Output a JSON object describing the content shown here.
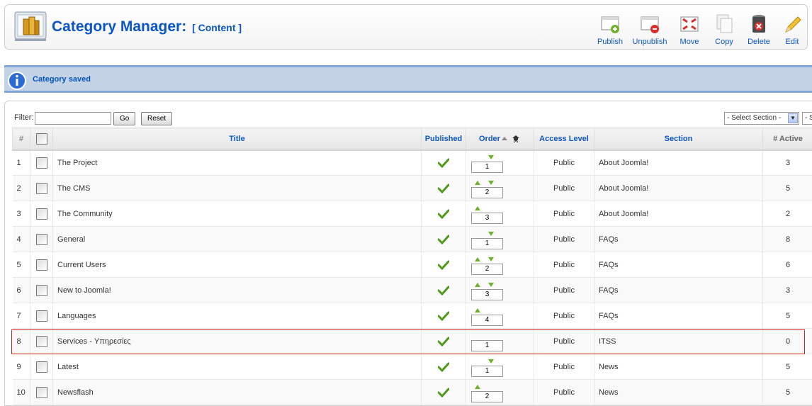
{
  "header": {
    "title": "Category Manager:",
    "subtitle": "[ Content ]"
  },
  "toolbar": {
    "publish": "Publish",
    "unpublish": "Unpublish",
    "move": "Move",
    "copy": "Copy",
    "delete": "Delete",
    "edit": "Edit"
  },
  "message": {
    "text": "Category saved"
  },
  "filter": {
    "label": "Filter:",
    "value": "",
    "go": "Go",
    "reset": "Reset",
    "section_select": "- Select Section -",
    "second_select": "- S"
  },
  "columns": {
    "num": "#",
    "title": "Title",
    "published": "Published",
    "order": "Order",
    "access": "Access Level",
    "section": "Section",
    "active": "# Active"
  },
  "rows": [
    {
      "num": "1",
      "title": "The Project",
      "up": false,
      "down": true,
      "order": "1",
      "access": "Public",
      "section": "About Joomla!",
      "active": "3"
    },
    {
      "num": "2",
      "title": "The CMS",
      "up": true,
      "down": true,
      "order": "2",
      "access": "Public",
      "section": "About Joomla!",
      "active": "5"
    },
    {
      "num": "3",
      "title": "The Community",
      "up": true,
      "down": false,
      "order": "3",
      "access": "Public",
      "section": "About Joomla!",
      "active": "2"
    },
    {
      "num": "4",
      "title": "General",
      "up": false,
      "down": true,
      "order": "1",
      "access": "Public",
      "section": "FAQs",
      "active": "8"
    },
    {
      "num": "5",
      "title": "Current Users",
      "up": true,
      "down": true,
      "order": "2",
      "access": "Public",
      "section": "FAQs",
      "active": "6"
    },
    {
      "num": "6",
      "title": "New to Joomla!",
      "up": true,
      "down": true,
      "order": "3",
      "access": "Public",
      "section": "FAQs",
      "active": "3"
    },
    {
      "num": "7",
      "title": "Languages",
      "up": true,
      "down": false,
      "order": "4",
      "access": "Public",
      "section": "FAQs",
      "active": "5"
    },
    {
      "num": "8",
      "title": "Services - Υπηρεσίες",
      "up": false,
      "down": false,
      "order": "1",
      "access": "Public",
      "section": "ITSS",
      "active": "0"
    },
    {
      "num": "9",
      "title": "Latest",
      "up": false,
      "down": true,
      "order": "1",
      "access": "Public",
      "section": "News",
      "active": "5"
    },
    {
      "num": "10",
      "title": "Newsflash",
      "up": true,
      "down": false,
      "order": "2",
      "access": "Public",
      "section": "News",
      "active": "5"
    }
  ]
}
